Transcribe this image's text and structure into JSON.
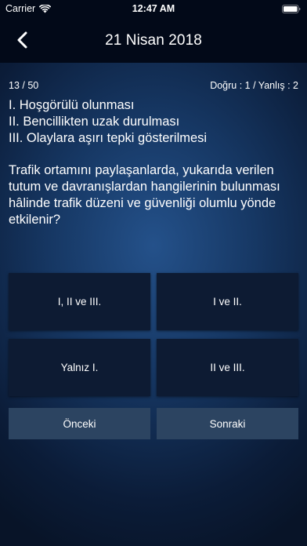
{
  "status_bar": {
    "carrier": "Carrier",
    "time": "12:47 AM",
    "icons": [
      "wifi-icon",
      "battery-icon"
    ]
  },
  "header": {
    "title": "21 Nisan 2018",
    "back_icon": "chevron-left-icon"
  },
  "progress": {
    "counter": "13 / 50",
    "score": "Doğru : 1 / Yanlış : 2"
  },
  "question": {
    "statements": [
      "I. Hoşgörülü olunması",
      "II. Bencillikten uzak durulması",
      "III. Olaylara aşırı tepki gösterilmesi"
    ],
    "text": "Trafik ortamını paylaşanlarda, yukarıda verilen tutum ve davranışlardan hangilerinin bulunması hâlinde trafik düzeni ve güvenliği olumlu yönde etkilenir?"
  },
  "answers": [
    {
      "label": "I, II ve III."
    },
    {
      "label": "I ve II."
    },
    {
      "label": "Yalnız I."
    },
    {
      "label": "II ve III."
    }
  ],
  "navigation": {
    "prev_label": "Önceki",
    "next_label": "Sonraki"
  },
  "colors": {
    "topbar": "#020918",
    "answer_bg": "#0d1b33",
    "nav_button_bg": "#2c4461",
    "background_center": "#24518a",
    "background_edge": "#081428"
  }
}
